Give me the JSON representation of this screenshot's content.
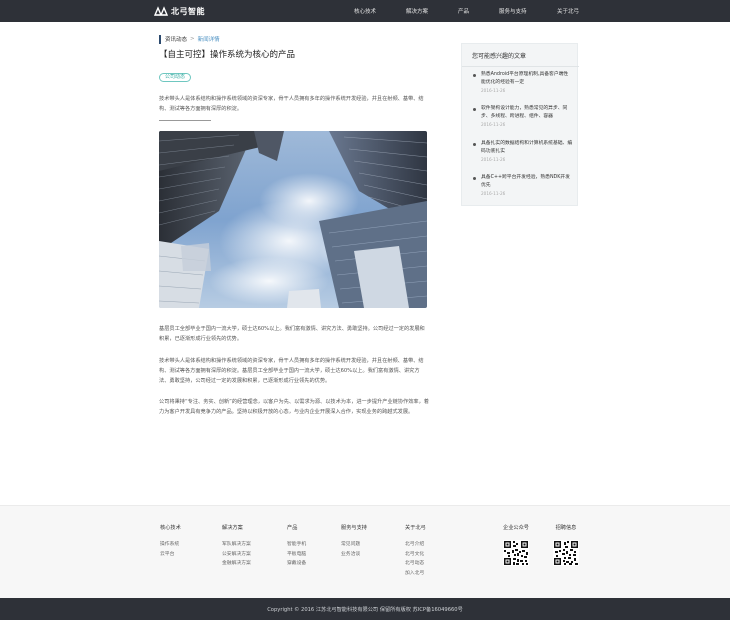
{
  "header": {
    "logo_text": "北弓智能",
    "nav": [
      "核心技术",
      "解决方案",
      "产品",
      "服务与支持",
      "关于北弓"
    ]
  },
  "breadcrumb": {
    "section": "资讯动态",
    "separator": ">",
    "current": "新闻详情"
  },
  "article": {
    "title": "【自主可控】操作系统为核心的产品",
    "tag": "公司动态",
    "lead": "技术带头人是体系结构和操作系统领域的资深专家，骨干人员拥有多年的操作系统开发经验，并且在射频、基带、结构、测试等各方面拥有深厚的积淀。",
    "paragraphs": [
      "基层员工全部毕业于国内一流大学，硕士达60%以上。我们富有激情、讲究方法、勇敢坚持。公司经过一定的发展和积累，已逐渐形成行业领先的优势。",
      "技术带头人是体系结构和操作系统领域的资深专家，骨干人员拥有多年的操作系统开发经验，并且在射频、基带、结构、测试等各方面拥有深厚的积淀。基层员工全部毕业于国内一流大学，硕士达60%以上。我们富有激情、讲究方法、勇敢坚持，公司经过一定的发展和积累，已逐渐形成行业领先的优势。",
      "公司将秉持“专注、务实、创新”的经营理念，以客户为先、以需求为源、以技术为本，进一步提升产业链协作效率，着力为客户开发具有竞争力的产品。坚持以积极开放的心态，与业内企业开展深入合作，实现业务的跨越式发展。"
    ]
  },
  "sidebar": {
    "title": "您可能感兴趣的文章",
    "items": [
      {
        "text": "熟悉Android平台原理机制,具备客户端性能优化的经验有一定",
        "date": "2016-11-26"
      },
      {
        "text": "软件架构设计能力，熟悉常见的异步、同步、多线程、跨进程、组件、容器",
        "date": "2016-11-26"
      },
      {
        "text": "具备扎实的数据结构和计算机系统基础、编码功底扎实",
        "date": "2016-11-26"
      },
      {
        "text": "具备C++跨平台开发经验，熟悉NDK开发优先",
        "date": "2016-11-26"
      }
    ]
  },
  "footer": {
    "columns": [
      {
        "title": "核心技术",
        "links": [
          "操作系统",
          "云平台"
        ]
      },
      {
        "title": "解决方案",
        "links": [
          "军队解决方案",
          "公安解决方案",
          "金融解决方案"
        ]
      },
      {
        "title": "产品",
        "links": [
          "智能手机",
          "平板电脑",
          "穿戴设备"
        ]
      },
      {
        "title": "服务与支持",
        "links": [
          "常见问题",
          "业务洽谈"
        ]
      },
      {
        "title": "关于北弓",
        "links": [
          "北弓介绍",
          "北弓文化",
          "北弓动态",
          "加入北弓"
        ]
      }
    ],
    "qr": [
      {
        "title": "企业公众号"
      },
      {
        "title": "招聘信息"
      }
    ],
    "copyright": "Copyright © 2016 江苏北弓智能科技有限公司 保留所有版权 苏ICP备16049660号"
  }
}
